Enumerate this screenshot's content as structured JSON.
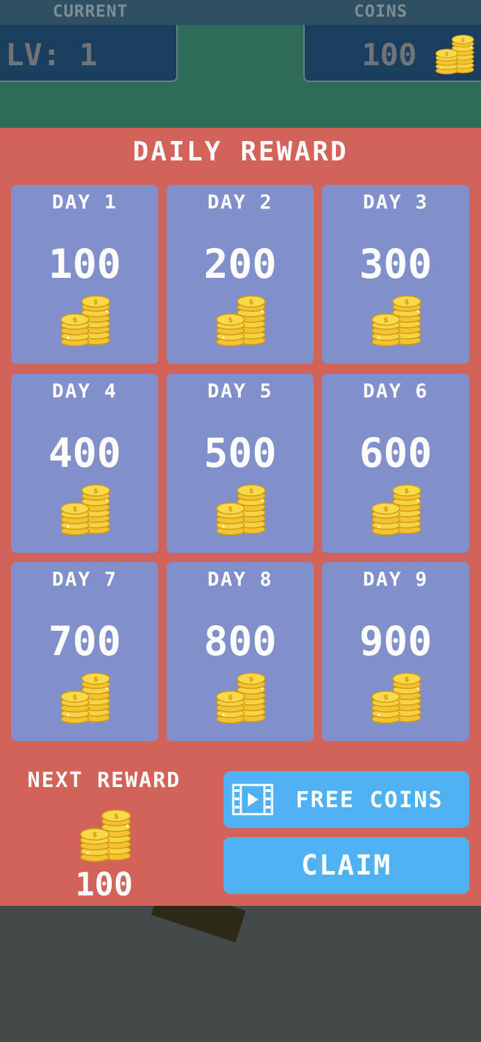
{
  "hud": {
    "level_label": "CURRENT",
    "level_value": "LV: 1",
    "coins_label": "COINS",
    "coins_value": "100"
  },
  "dialog": {
    "title": "DAILY REWARD",
    "days": [
      {
        "day": "DAY 1",
        "amount": "100"
      },
      {
        "day": "DAY 2",
        "amount": "200"
      },
      {
        "day": "DAY 3",
        "amount": "300"
      },
      {
        "day": "DAY 4",
        "amount": "400"
      },
      {
        "day": "DAY 5",
        "amount": "500"
      },
      {
        "day": "DAY 6",
        "amount": "600"
      },
      {
        "day": "DAY 7",
        "amount": "700"
      },
      {
        "day": "DAY 8",
        "amount": "800"
      },
      {
        "day": "DAY 9",
        "amount": "900"
      }
    ],
    "next_reward_label": "NEXT REWARD",
    "next_reward_amount": "100",
    "free_coins_label": "FREE COINS",
    "claim_label": "CLAIM",
    "icons": {
      "coins": "coin-stack-icon",
      "video": "video-play-icon"
    }
  }
}
